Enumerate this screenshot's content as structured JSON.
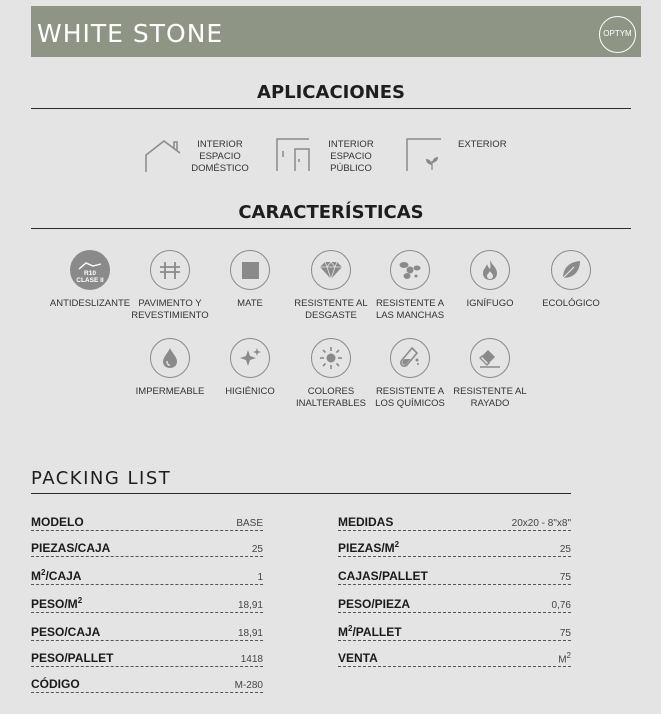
{
  "header": {
    "title": "WHITE STONE",
    "brand": "OPTYM"
  },
  "applications": {
    "heading": "APLICACIONES",
    "items": [
      {
        "icon": "house-icon",
        "lines": [
          "INTERIOR",
          "ESPACIO",
          "DOMÉSTICO"
        ]
      },
      {
        "icon": "building-door-icon",
        "lines": [
          "INTERIOR",
          "ESPACIO",
          "PÚBLICO"
        ]
      },
      {
        "icon": "exterior-plant-icon",
        "lines": [
          "EXTERIOR"
        ]
      }
    ]
  },
  "features": {
    "heading": "CARACTERÍSTICAS",
    "badge": {
      "line1": "R10",
      "line2": "CLASE II"
    },
    "items": [
      {
        "icon": "slip-resistance-icon",
        "lines": [
          "ANTIDESLIZANTE"
        ]
      },
      {
        "icon": "table-icon",
        "lines": [
          "PAVIMENTO Y",
          "REVESTIMIENTO"
        ]
      },
      {
        "icon": "square-icon",
        "lines": [
          "MATE"
        ]
      },
      {
        "icon": "diamond-icon",
        "lines": [
          "RESISTENTE AL",
          "DESGASTE"
        ]
      },
      {
        "icon": "stain-icon",
        "lines": [
          "RESISTENTE A",
          "LAS MANCHAS"
        ]
      },
      {
        "icon": "flame-icon",
        "lines": [
          "IGNÍFUGO"
        ]
      },
      {
        "icon": "leaf-icon",
        "lines": [
          "ECOLÓGICO"
        ]
      },
      {
        "icon": "drop-icon",
        "lines": [
          "IMPERMEABLE"
        ]
      },
      {
        "icon": "sparkle-icon",
        "lines": [
          "HIGIÉNICO"
        ]
      },
      {
        "icon": "sun-icon",
        "lines": [
          "COLORES",
          "INALTERABLES"
        ]
      },
      {
        "icon": "test-tube-icon",
        "lines": [
          "RESISTENTE A",
          "LOS QUÍMICOS"
        ]
      },
      {
        "icon": "eraser-icon",
        "lines": [
          "RESISTENTE AL",
          "RAYADO"
        ]
      }
    ]
  },
  "packing": {
    "title": "PACKING LIST",
    "left": [
      {
        "label": "MODELO",
        "value": "BASE"
      },
      {
        "label": "PIEZAS/CAJA",
        "value": "25"
      },
      {
        "label": "M",
        "label_sup": "2",
        "label_post": "/CAJA",
        "value": "1"
      },
      {
        "label": "PESO/M",
        "label_sup": "2",
        "value": "18,91"
      },
      {
        "label": "PESO/CAJA",
        "value": "18,91"
      },
      {
        "label": "PESO/PALLET",
        "value": "1418"
      },
      {
        "label": "CÓDIGO",
        "value": "M-280"
      }
    ],
    "right": [
      {
        "label": "MEDIDAS",
        "value": "20x20 - 8\"x8\""
      },
      {
        "label": "PIEZAS/M",
        "label_sup": "2",
        "value": "25"
      },
      {
        "label": "CAJAS/PALLET",
        "value": "75"
      },
      {
        "label": "PESO/PIEZA",
        "value": "0,76"
      },
      {
        "label": "M",
        "label_sup": "2",
        "label_post": "/PALLET",
        "value": "75"
      },
      {
        "label": "VENTA",
        "value": "M",
        "value_sup": "2"
      }
    ]
  }
}
